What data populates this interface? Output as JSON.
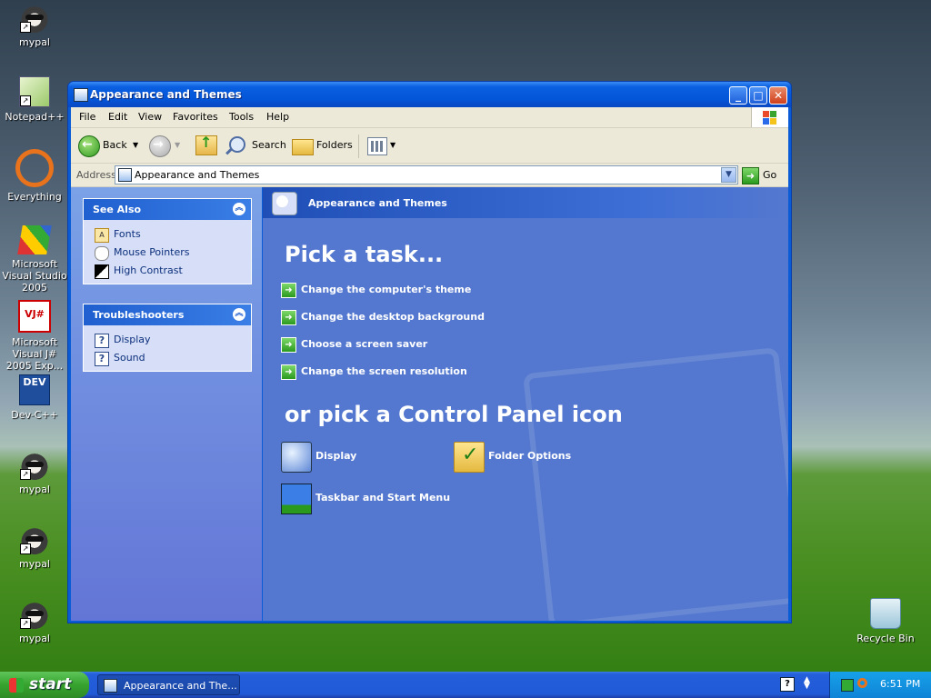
{
  "desktop": {
    "icons": [
      {
        "label": "mypal"
      },
      {
        "label": "Notepad++"
      },
      {
        "label": "Everything"
      },
      {
        "label": "Microsoft Visual Studio 2005"
      },
      {
        "label": "Microsoft Visual J# 2005 Exp..."
      },
      {
        "label": "Dev-C++"
      },
      {
        "label": "mypal"
      },
      {
        "label": "mypal"
      },
      {
        "label": "mypal"
      },
      {
        "label": "Recycle Bin"
      }
    ]
  },
  "window": {
    "title": "Appearance and Themes",
    "menu": [
      "File",
      "Edit",
      "View",
      "Favorites",
      "Tools",
      "Help"
    ],
    "toolbar": {
      "back": "Back",
      "search": "Search",
      "folders": "Folders"
    },
    "address": {
      "label": "Address",
      "value": "Appearance and Themes",
      "go": "Go"
    }
  },
  "sidebar": {
    "see_also": {
      "title": "See Also",
      "items": [
        {
          "label": "Fonts"
        },
        {
          "label": "Mouse Pointers"
        },
        {
          "label": "High Contrast"
        }
      ]
    },
    "troubleshooters": {
      "title": "Troubleshooters",
      "items": [
        {
          "label": "Display"
        },
        {
          "label": "Sound"
        }
      ]
    }
  },
  "main": {
    "header": "Appearance and Themes",
    "pick_task": "Pick a task...",
    "tasks": [
      {
        "label": "Change the computer's theme"
      },
      {
        "label": "Change the desktop background"
      },
      {
        "label": "Choose a screen saver"
      },
      {
        "label": "Change the screen resolution"
      }
    ],
    "pick_icon": "or pick a Control Panel icon",
    "icons": [
      {
        "label": "Display"
      },
      {
        "label": "Folder Options"
      },
      {
        "label": "Taskbar and Start Menu"
      }
    ]
  },
  "taskbar": {
    "start": "start",
    "task_button": "Appearance and The...",
    "clock": "6:51 PM"
  }
}
